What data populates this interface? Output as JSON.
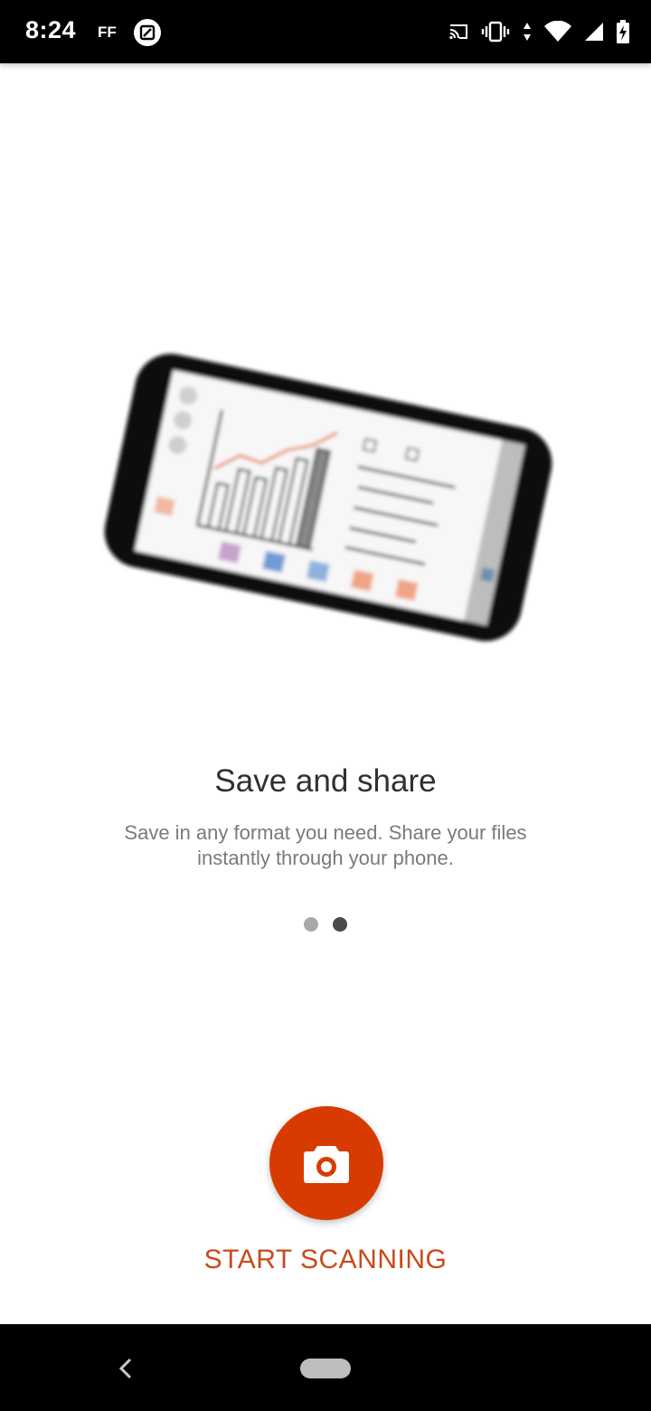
{
  "status_bar": {
    "time": "8:24",
    "notification_text": "FF",
    "icons": [
      "edit-image-icon",
      "cast-icon",
      "vibrate-icon",
      "data-arrows-icon",
      "wifi-icon",
      "signal-icon",
      "battery-charging-icon"
    ]
  },
  "onboarding": {
    "title": "Save and share",
    "description": "Save in any format you need. Share your files instantly through your phone.",
    "page_count": 2,
    "active_page": 2
  },
  "action": {
    "fab_icon": "camera-icon",
    "label": "START SCANNING"
  },
  "colors": {
    "accent": "#d83b01",
    "label": "#c94a1a",
    "dot_inactive": "#a8a8a8",
    "dot_active": "#4a4a4a"
  },
  "nav_bar": {
    "icons": [
      "back-icon",
      "home-pill-icon"
    ]
  }
}
